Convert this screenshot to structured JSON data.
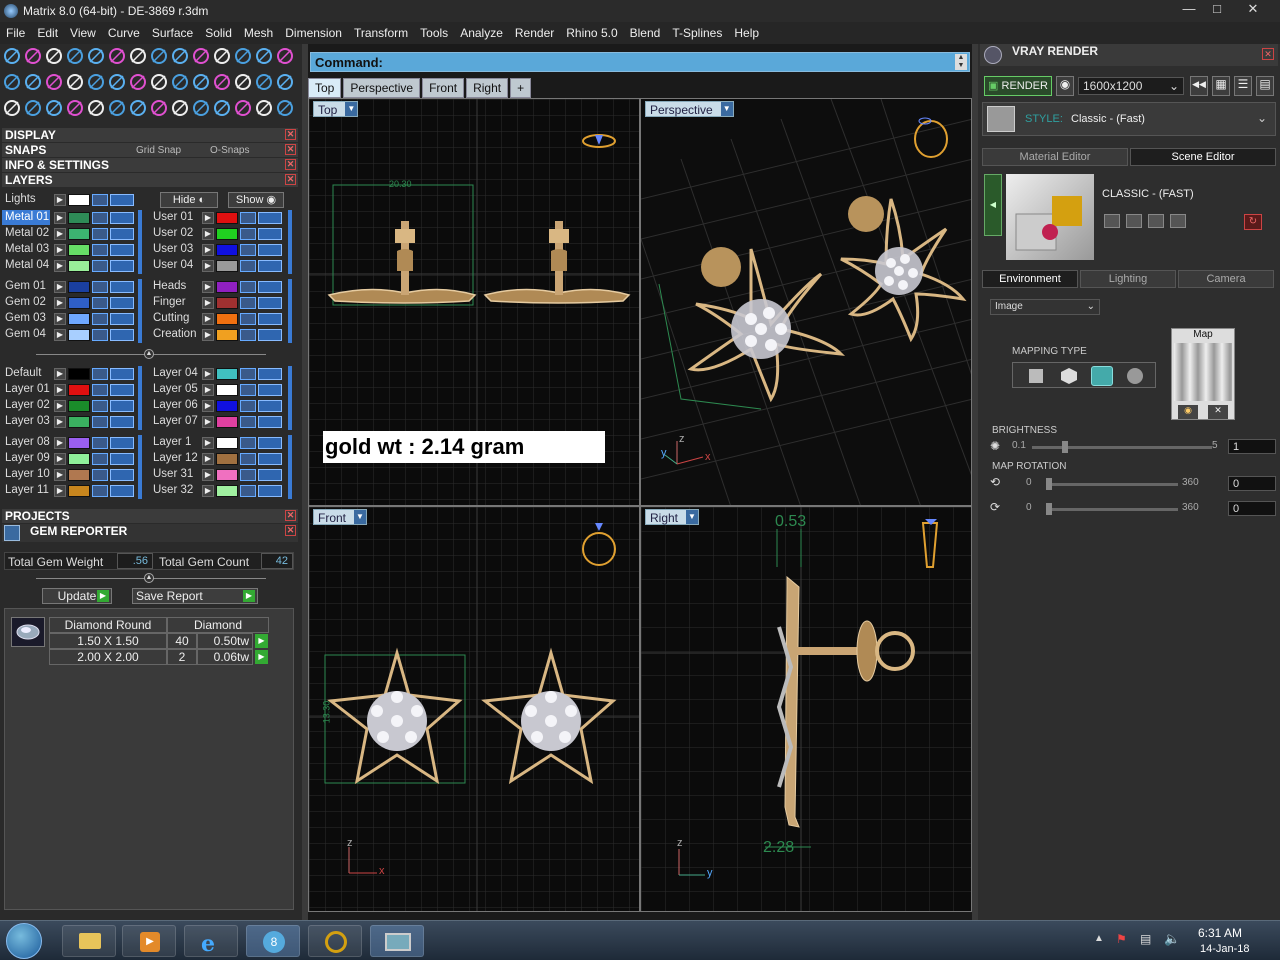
{
  "window": {
    "title": "Matrix 8.0 (64-bit) - DE-3869 r.3dm",
    "minimize": "—",
    "maximize": "□",
    "close": "✕"
  },
  "menu": [
    "File",
    "Edit",
    "View",
    "Curve",
    "Surface",
    "Solid",
    "Mesh",
    "Dimension",
    "Transform",
    "Tools",
    "Analyze",
    "Render",
    "Rhino 5.0",
    "Blend",
    "T-Splines",
    "Help"
  ],
  "left": {
    "sections": {
      "display": "DISPLAY",
      "snaps": "SNAPS",
      "info": "INFO & SETTINGS",
      "layers": "LAYERS",
      "projects": "PROJECTS",
      "gem_reporter": "GEM REPORTER"
    },
    "snap_tabs": {
      "grid": "Grid Snap",
      "osnap": "O-Snaps"
    },
    "lights": "Lights",
    "hide": "Hide",
    "show": "Show",
    "layers_left": [
      {
        "name": "Metal 01",
        "color": "#2e8b57"
      },
      {
        "name": "Metal 02",
        "color": "#3cb371"
      },
      {
        "name": "Metal 03",
        "color": "#66dd66"
      },
      {
        "name": "Metal 04",
        "color": "#99ee99"
      },
      {
        "name": "Gem 01",
        "color": "#1a3fa0"
      },
      {
        "name": "Gem 02",
        "color": "#2f5fc7"
      },
      {
        "name": "Gem 03",
        "color": "#6fa8ff"
      },
      {
        "name": "Gem 04",
        "color": "#a8cfff"
      },
      {
        "name": "Default",
        "color": "#000000"
      },
      {
        "name": "Layer 01",
        "color": "#e01010"
      },
      {
        "name": "Layer 02",
        "color": "#1a8c2a"
      },
      {
        "name": "Layer 03",
        "color": "#3ab060"
      },
      {
        "name": "Layer 08",
        "color": "#9a5ff0"
      },
      {
        "name": "Layer 09",
        "color": "#8ff09a"
      },
      {
        "name": "Layer 10",
        "color": "#b07850"
      },
      {
        "name": "Layer 11",
        "color": "#c8861e"
      }
    ],
    "layers_right": [
      {
        "name": "User 01",
        "color": "#e01010"
      },
      {
        "name": "User 02",
        "color": "#20d020"
      },
      {
        "name": "User 03",
        "color": "#1010e0"
      },
      {
        "name": "User 04",
        "color": "#9a9a9a"
      },
      {
        "name": "Heads",
        "color": "#9020c0"
      },
      {
        "name": "Finger",
        "color": "#a03030"
      },
      {
        "name": "Cutting",
        "color": "#f07010"
      },
      {
        "name": "Creation",
        "color": "#f0a020"
      },
      {
        "name": "Layer 04",
        "color": "#40c0c0"
      },
      {
        "name": "Layer 05",
        "color": "#ffffff"
      },
      {
        "name": "Layer 06",
        "color": "#1010e0"
      },
      {
        "name": "Layer 07",
        "color": "#e040a0"
      },
      {
        "name": "Layer 1",
        "color": "#ffffff"
      },
      {
        "name": "Layer 12",
        "color": "#a07040"
      },
      {
        "name": "User 31",
        "color": "#f070c0"
      },
      {
        "name": "User 32",
        "color": "#a0f0a0"
      }
    ],
    "gem": {
      "total_weight_label": "Total Gem Weight",
      "total_weight": ".56",
      "total_count_label": "Total Gem Count",
      "total_count": "42",
      "update": "Update",
      "save_report": "Save Report",
      "col1": "Diamond Round",
      "col2": "Diamond",
      "rows": [
        {
          "size": "1.50 X 1.50",
          "count": "40",
          "weight": "0.50tw"
        },
        {
          "size": "2.00 X 2.00",
          "count": "2",
          "weight": "0.06tw"
        }
      ]
    }
  },
  "command": {
    "label": "Command:"
  },
  "viewport_tabs": [
    "Top",
    "Perspective",
    "Front",
    "Right",
    "+"
  ],
  "viewports": {
    "top": {
      "label": "Top",
      "dimension": "20.30",
      "note": "gold wt : 2.14 gram"
    },
    "perspective": {
      "label": "Perspective"
    },
    "front": {
      "label": "Front",
      "dimension": "13.30"
    },
    "right": {
      "label": "Right",
      "dim_top": "0.53",
      "dim_bottom": "2.28"
    }
  },
  "axes": {
    "x": "x",
    "y": "y",
    "z": "z"
  },
  "vray": {
    "title": "VRAY RENDER",
    "render": "RENDER",
    "resolution": "1600x1200",
    "style_label": "STYLE:",
    "style_value": "Classic - (Fast)",
    "tabs": [
      "Material Editor",
      "Scene Editor"
    ],
    "preset_name": "CLASSIC - (FAST)",
    "env_tabs": [
      "Environment",
      "Lighting",
      "Camera"
    ],
    "env_mode": "Image",
    "mapping_type": "MAPPING TYPE",
    "map_label": "Map",
    "brightness": {
      "label": "BRIGHTNESS",
      "min": "0.1",
      "max": "5",
      "value": "1"
    },
    "map_rotation": {
      "label": "MAP ROTATION",
      "h_min": "0",
      "h_max": "360",
      "h_value": "0",
      "v_min": "0",
      "v_max": "360",
      "v_value": "0"
    }
  },
  "clock": {
    "time": "6:31 AM",
    "date": "14-Jan-18"
  }
}
